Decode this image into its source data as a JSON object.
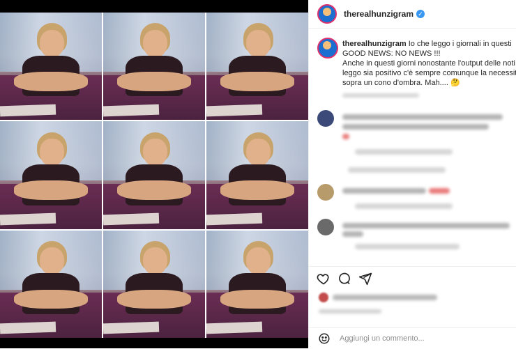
{
  "post": {
    "username": "therealhunzigram",
    "verified_icon": "verified-badge-icon",
    "caption": {
      "username": "therealhunzigram",
      "lines": [
        "Io che leggo i giornali in questi",
        "GOOD NEWS: NO NEWS !!!",
        "Anche in questi giorni nonostante l'output delle noti",
        "leggo sia positivo c'è sempre comunque la necessità",
        "sopra un cono d'ombra. Mah.... 🤔"
      ]
    },
    "add_comment_placeholder": "Aggiungi un commento..."
  },
  "icons": {
    "like": "heart-icon",
    "comment": "comment-bubble-icon",
    "share": "paper-plane-icon",
    "emoji": "emoji-smile-icon"
  },
  "colors": {
    "accent_story_ring": "#e1306c",
    "verified": "#3897f0",
    "text": "#262626",
    "muted": "#8e8e8e"
  }
}
